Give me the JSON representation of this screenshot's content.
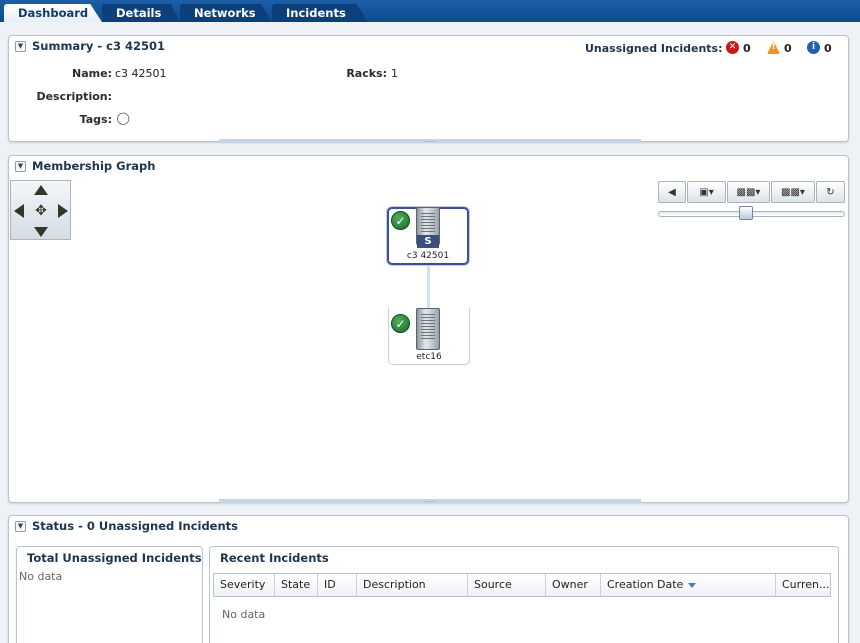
{
  "tabs": [
    {
      "label": "Dashboard",
      "active": true
    },
    {
      "label": "Details",
      "active": false
    },
    {
      "label": "Networks",
      "active": false
    },
    {
      "label": "Incidents",
      "active": false
    }
  ],
  "summary": {
    "title": "Summary - c3 42501",
    "unassigned_label": "Unassigned Incidents:",
    "critical_count": "0",
    "warning_count": "0",
    "info_count": "0",
    "name_label": "Name:",
    "name_value": "c3 42501",
    "racks_label": "Racks:",
    "racks_value": "1",
    "description_label": "Description:",
    "tags_label": "Tags:"
  },
  "graph": {
    "title": "Membership Graph",
    "nodes": [
      {
        "label": "c3 42501",
        "badge": "S",
        "status": "ok"
      },
      {
        "label": "etc16",
        "status": "ok"
      }
    ]
  },
  "status": {
    "title": "Status - 0 Unassigned Incidents",
    "total_title": "Total Unassigned Incidents",
    "total_no_data": "No data",
    "recent_title": "Recent Incidents",
    "columns": [
      "Severity",
      "State",
      "ID",
      "Description",
      "Source",
      "Owner",
      "Creation Date",
      "Curren..."
    ],
    "recent_no_data": "No data"
  },
  "colors": {
    "tab_bar": "#1c5ea8",
    "header_text": "#1d3550",
    "critical": "#c41a1a",
    "warning": "#e89a1c",
    "info": "#1f5fb5",
    "ok": "#2e8b3e"
  }
}
